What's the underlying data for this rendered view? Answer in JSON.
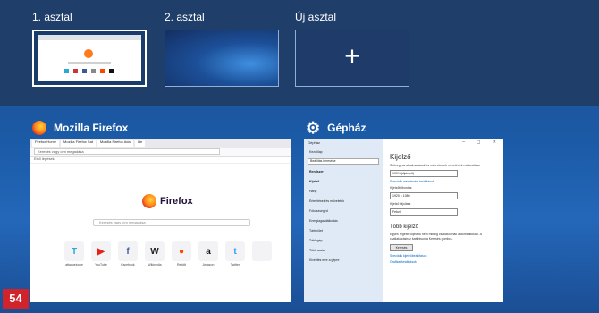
{
  "desktops": [
    {
      "label": "1. asztal"
    },
    {
      "label": "2. asztal"
    },
    {
      "label": "Új asztal",
      "icon": "plus-icon"
    }
  ],
  "windows": {
    "firefox": {
      "title": "Mozilla Firefox",
      "tab_labels": [
        "Firefox Home",
        "Mozilla Firefox Sat",
        "Mozilla Firefox Ada",
        "Ide"
      ],
      "url": "Keresés vagy cím megadása",
      "bookmark": "Első lépések",
      "logo_text": "Firefox",
      "search_placeholder": "Keresés vagy cím megadása",
      "sites": [
        {
          "label": "attaquejocke",
          "icon": "T",
          "color": "#2aa7d6"
        },
        {
          "label": "YouTube",
          "icon": "▶",
          "color": "#e62117"
        },
        {
          "label": "Facebook",
          "icon": "f",
          "color": "#3b5998"
        },
        {
          "label": "Wikipedia",
          "icon": "W",
          "color": "#222222"
        },
        {
          "label": "Reddit",
          "icon": "●",
          "color": "#ff4500"
        },
        {
          "label": "Amazon",
          "icon": "a",
          "color": "#111111"
        },
        {
          "label": "Twitter",
          "icon": "t",
          "color": "#1da1f2"
        },
        {
          "label": "",
          "icon": "",
          "color": "#f3f3f6"
        }
      ]
    },
    "settings": {
      "title": "Gépház",
      "app_name": "Gépház",
      "home": "Kezdőlap",
      "search_placeholder": "Beállítás keresése",
      "section": "Rendszer",
      "nav": [
        "Kijelző",
        "Hang",
        "Értesítések és műveletek",
        "Fókuszsegéd",
        "Energiagazdálkodás",
        "Tárterület",
        "Táblagép",
        "Több asztal",
        "Kivetítés erre a gépre"
      ],
      "heading": "Kijelző",
      "scale_label": "Szöveg, az alkalmazások és más elemek méretének módosítása",
      "scale_value": "100% (Ajánlott)",
      "scale_link": "Speciális méretezési beállítások",
      "resolution_label": "Kijelzőfelbontás",
      "resolution_value": "1920 × 1080",
      "orientation_label": "Kijelző tájolása",
      "orientation_value": "Fekvő",
      "multi_heading": "Több kijelző",
      "multi_text": "Egyes régebbi kijelzők nem mindig csatlakoznak automatikusan. A csatlakozáshoz kattintson a Keresés gombra.",
      "detect_button": "Keresés",
      "advanced_link": "Speciális kijelzőbeállítások",
      "graphics_link": "Grafikai beállítások"
    }
  },
  "page_number": "54"
}
